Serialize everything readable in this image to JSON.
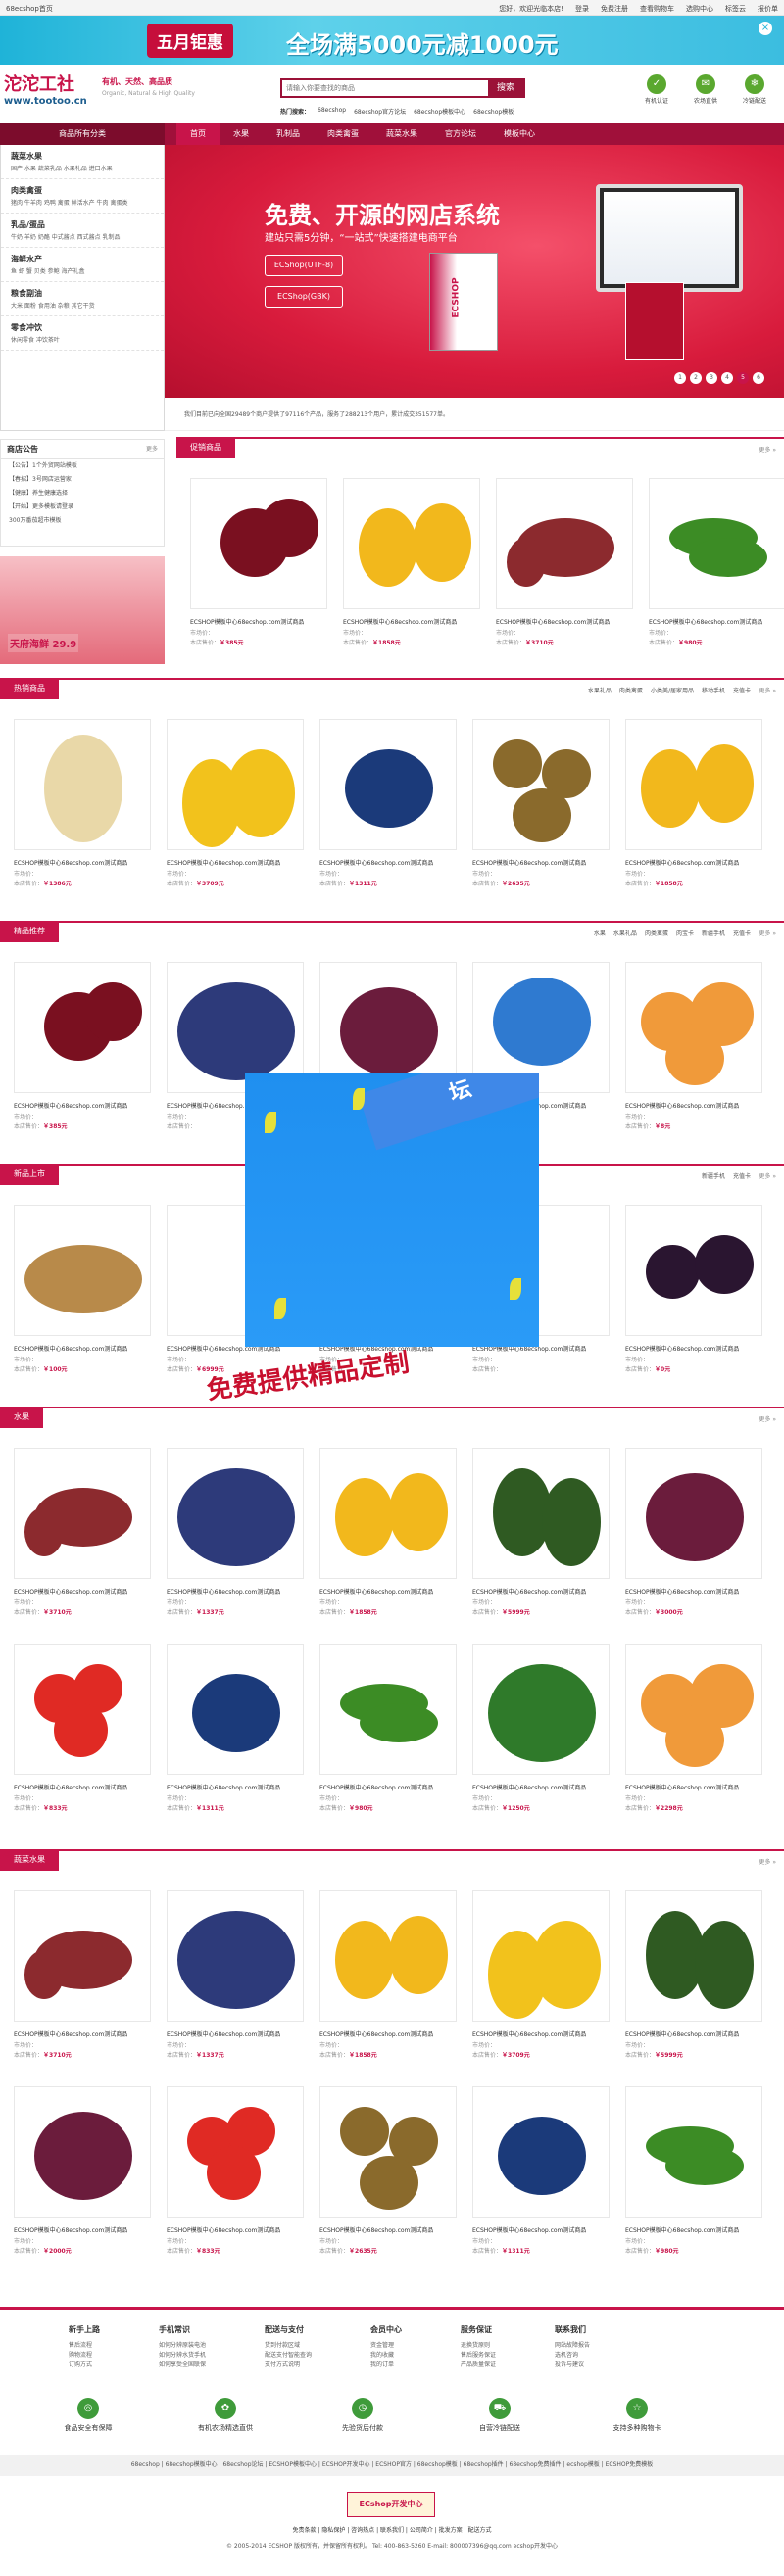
{
  "topbar": {
    "left": "68ecshop首页",
    "links": [
      "您好，欢迎光临本店!",
      "登录",
      "免费注册",
      "查看购物车",
      "选购中心",
      "标签云",
      "报价单"
    ]
  },
  "promo": {
    "month": "五月钜惠",
    "text": "全场满5000元减1000元",
    "close": "×"
  },
  "logo": {
    "cn": "沱沱工社",
    "en": "www.tootoo.cn"
  },
  "slogan": {
    "line1": "有机、天然、高品质",
    "line2": "Organic, Natural & High Quality"
  },
  "search": {
    "placeholder": "请输入你要查找的商品",
    "button": "搜索",
    "hot_label": "热门搜索：",
    "hot": [
      "68ecshop",
      "68ecshop官方论坛",
      "68ecshop模板中心",
      "68ecshop模板"
    ]
  },
  "badges": [
    {
      "icon": "✓",
      "label": "有机认证"
    },
    {
      "icon": "✉",
      "label": "农场直供"
    },
    {
      "icon": "❄",
      "label": "冷链配送"
    }
  ],
  "nav": {
    "category": "商品所有分类",
    "items": [
      "首页",
      "水果",
      "乳制品",
      "肉类禽蛋",
      "蔬菜水果",
      "官方论坛",
      "模板中心"
    ]
  },
  "categories": [
    {
      "title": "蔬菜水果",
      "items": "国产 水果 蔬菜乳品 水果礼品 进口水果"
    },
    {
      "title": "肉类禽蛋",
      "items": "猪肉 牛羊肉 鸡鸭 禽蛋 鲜活水产 牛肉 禽蛋类"
    },
    {
      "title": "乳品/蛋品",
      "items": "牛奶 羊奶 奶酪 中式酱点 西式酱点 乳制品"
    },
    {
      "title": "海鲜水产",
      "items": "鱼 虾 蟹 贝类 参鲍 海产礼盒"
    },
    {
      "title": "粮食副油",
      "items": "大米 面粉 食用油 杂粮 其它干货"
    },
    {
      "title": "零食冲饮",
      "items": "休闲零食 冲饮茶叶"
    }
  ],
  "banner": {
    "title": "免费、开源的网店系统",
    "subtitle": "建站只需5分钟，“一站式”快速搭建电商平台",
    "btn1": "ECShop(UTF-8)",
    "btn2": "ECShop(GBK)",
    "box": "ECSHOP",
    "pages": [
      "1",
      "2",
      "3",
      "4",
      "5",
      "6"
    ]
  },
  "notice": "我们目前已向全国29489个商户提供了97116个产品，服务了288213个用户，累计成交351577单。",
  "news": {
    "title": "商店公告",
    "more": "更多",
    "items": [
      "【公告】1个外贸网站模板",
      "【春招】3号网店运营家",
      "【健康】养生健康选择",
      "【开始】更多模板请登录",
      "300万番茄超市模板"
    ]
  },
  "side_ad": {
    "text": "天府海鲜 29.9"
  },
  "sections": [
    {
      "name": "促销商品",
      "tabs": [],
      "more": "更多"
    },
    {
      "name": "热销商品",
      "tabs": [
        "水果礼品",
        "肉类禽蛋",
        "小类美/居家用品",
        "移动手机",
        "充值卡"
      ],
      "more": "更多"
    },
    {
      "name": "精品推荐",
      "tabs": [
        "水果",
        "水果礼品",
        "肉类禽蛋",
        "肉宝卡",
        "新疆手机",
        "充值卡"
      ],
      "more": "更多"
    },
    {
      "name": "新品上市",
      "tabs": [
        "新疆手机",
        "充值卡"
      ],
      "more": "更多"
    },
    {
      "name": "水果",
      "tabs": [],
      "more": "更多"
    },
    {
      "name": "蔬菜水果",
      "tabs": [],
      "more": "更多"
    }
  ],
  "product": {
    "name": "ECSHOP模板中心68ecshop.com测试商品",
    "market_label": "市场价：",
    "shop_label": "本店售价：",
    "member_label": "团购价："
  },
  "prices": {
    "promo": [
      "￥385元",
      "￥1858元",
      "￥3710元",
      "￥980元"
    ],
    "hot": [
      "￥1386元",
      "￥3709元",
      "￥1311元",
      "￥2635元",
      "￥1858元"
    ],
    "best": [
      "￥385元",
      "",
      "",
      "",
      "￥8元"
    ],
    "new": [
      "￥100元",
      "￥6999元",
      "",
      "",
      "￥0元"
    ],
    "fruit1": [
      "￥3710元",
      "￥1337元",
      "￥1858元",
      "￥5999元",
      "￥3000元"
    ],
    "fruit2": [
      "￥833元",
      "￥1311元",
      "￥980元",
      "￥1250元",
      "￥2298元"
    ],
    "veg1": [
      "￥3710元",
      "￥1337元",
      "￥1858元",
      "￥3709元",
      "￥5999元"
    ],
    "veg2": [
      "￥2000元",
      "￥833元",
      "￥2635元",
      "￥1311元",
      "￥980元"
    ]
  },
  "popup": {
    "banner": "坛",
    "stamp": "免费提供精品定制"
  },
  "footer": {
    "cols": [
      {
        "title": "新手上路",
        "items": [
          "售后流程",
          "购物流程",
          "订购方式"
        ]
      },
      {
        "title": "手机常识",
        "items": [
          "如何分辨原装电池",
          "如何分辨水货手机",
          "如何享受全国联保"
        ]
      },
      {
        "title": "配送与支付",
        "items": [
          "货到付款区域",
          "配送支付智能查询",
          "支付方式说明"
        ]
      },
      {
        "title": "会员中心",
        "items": [
          "资金管理",
          "我的收藏",
          "我的订单"
        ]
      },
      {
        "title": "服务保证",
        "items": [
          "退换货原则",
          "售后服务保证",
          "产品质量保证"
        ]
      },
      {
        "title": "联系我们",
        "items": [
          "网站故障报告",
          "选机咨询",
          "投诉与建议"
        ]
      }
    ],
    "services": [
      {
        "icon": "◎",
        "label": "食品安全有保障"
      },
      {
        "icon": "✿",
        "label": "有机农场精选直供"
      },
      {
        "icon": "◷",
        "label": "先验货后付款"
      },
      {
        "icon": "⛟",
        "label": "自营冷链配送"
      },
      {
        "icon": "☆",
        "label": "支持多种购物卡"
      }
    ],
    "links": "68ecshop | 68ecshop模板中心 | 68ecshop论坛 | ECSHOP模板中心 | ECSHOP开发中心 | ECSHOP官方 | 68ecshop模板 | 68ecshop插件 | 68ecshop免费插件 | ecshop模板 | ECSHOP免费模板",
    "brand": "ECshop开发中心",
    "menu": "免责条款 | 隐私保护 | 咨询热点 | 联系我们 | 公司简介 | 批发方案 | 配送方式",
    "copy": "© 2005-2014 ECSHOP 版权所有，并保留所有权利。 Tel: 400-863-5260  E-mail: 800007396@qq.com  ecshop开发中心"
  }
}
